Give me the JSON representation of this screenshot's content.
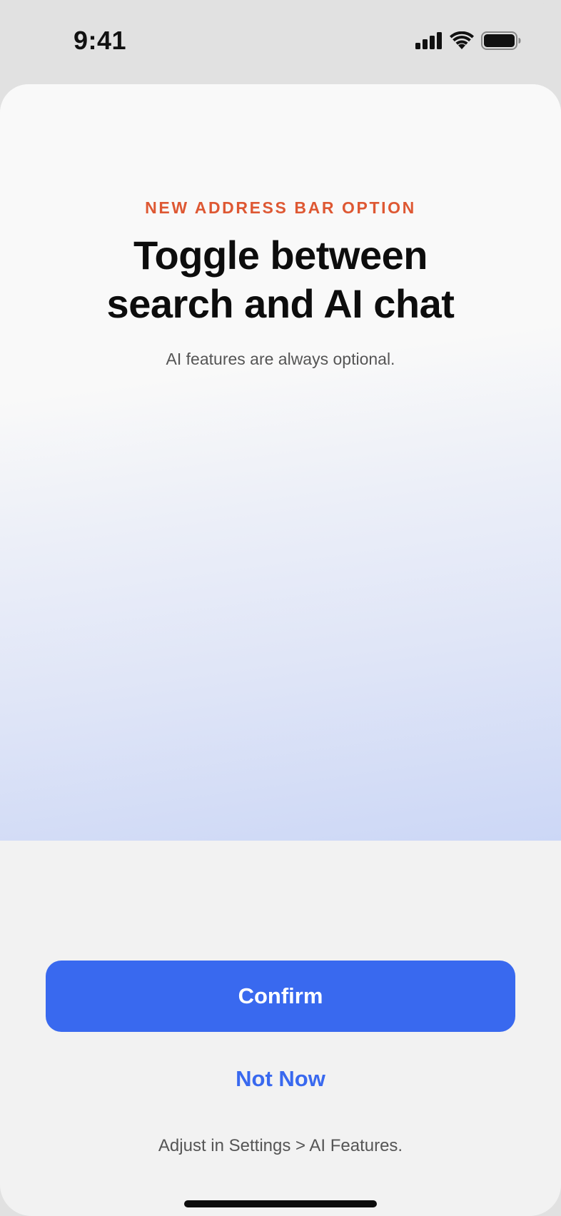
{
  "status_bar": {
    "time": "9:41",
    "icons": [
      "cellular-signal-icon",
      "wifi-icon",
      "battery-icon"
    ]
  },
  "onboarding": {
    "eyebrow": "NEW ADDRESS BAR OPTION",
    "headline_line1": "Toggle between",
    "headline_line2": "search and AI chat",
    "subtext": "AI features are always optional."
  },
  "actions": {
    "confirm_label": "Confirm",
    "not_now_label": "Not Now"
  },
  "footnote": "Adjust in Settings > AI Features.",
  "colors": {
    "accent": "#3969ef",
    "eyebrow": "#de5833",
    "text_primary": "#0d0d0d",
    "text_secondary": "#555555"
  }
}
